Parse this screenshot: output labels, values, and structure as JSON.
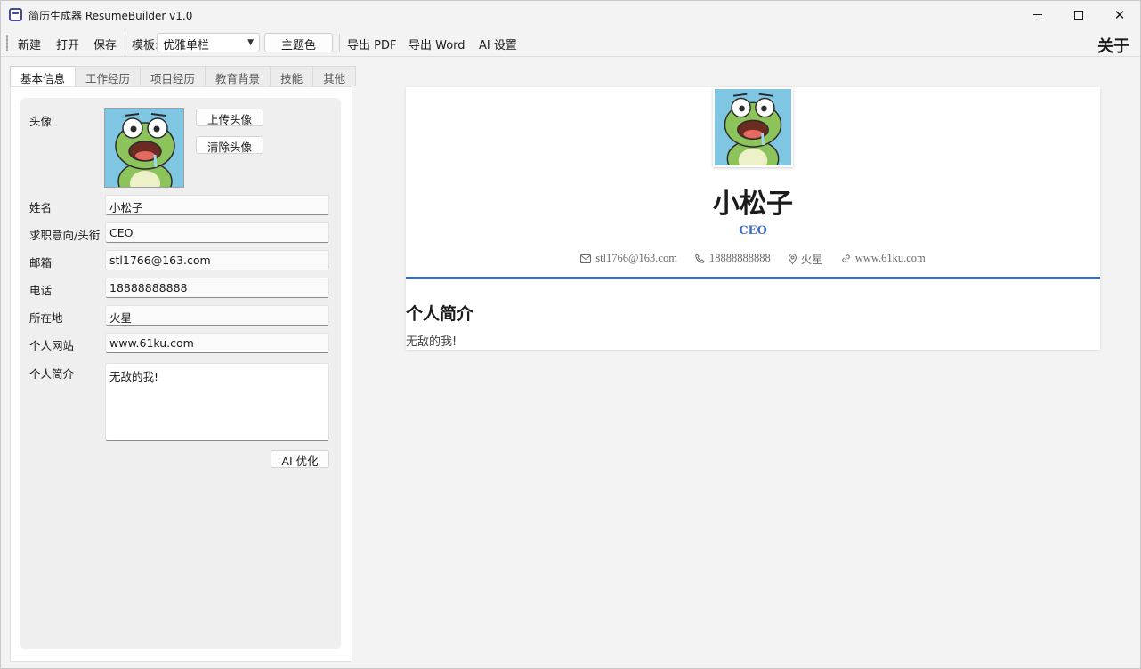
{
  "window": {
    "title": "简历生成器 ResumeBuilder  v1.0"
  },
  "toolbar": {
    "new_label": "新建",
    "open_label": "打开",
    "save_label": "保存",
    "template_label": "模板:",
    "template_value": "优雅单栏",
    "theme_label": "主题色",
    "export_pdf_label": "导出 PDF",
    "export_word_label": "导出 Word",
    "ai_settings_label": "AI 设置",
    "about_label": "关于"
  },
  "tabs": [
    {
      "label": "基本信息",
      "active": true
    },
    {
      "label": "工作经历",
      "active": false
    },
    {
      "label": "项目经历",
      "active": false
    },
    {
      "label": "教育背景",
      "active": false
    },
    {
      "label": "技能",
      "active": false
    },
    {
      "label": "其他",
      "active": false
    }
  ],
  "form": {
    "avatar_label": "头像",
    "upload_avatar_label": "上传头像",
    "clear_avatar_label": "清除头像",
    "name_label": "姓名",
    "name_value": "小松子",
    "job_label": "求职意向/头衔",
    "job_value": "CEO",
    "email_label": "邮箱",
    "email_value": "stl1766@163.com",
    "phone_label": "电话",
    "phone_value": "18888888888",
    "location_label": "所在地",
    "location_value": "火星",
    "website_label": "个人网站",
    "website_value": "www.61ku.com",
    "summary_label": "个人简介",
    "summary_value": "无敌的我!",
    "ai_optimize_label": "AI 优化"
  },
  "preview": {
    "name": "小松子",
    "title": "CEO",
    "email": "stl1766@163.com",
    "phone": "18888888888",
    "location": "火星",
    "website": "www.61ku.com",
    "summary_heading": "个人简介",
    "summary_text": "无敌的我!"
  },
  "colors": {
    "accent": "#3a6bc9",
    "avatar_bg": "#7fc6e3"
  }
}
